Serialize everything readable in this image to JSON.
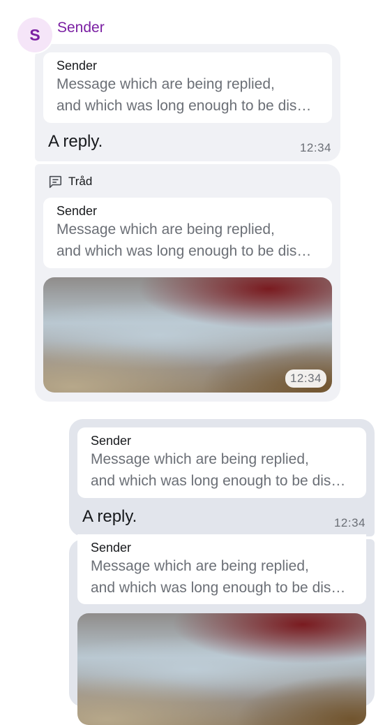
{
  "sender": {
    "initial": "S",
    "name": "Sender"
  },
  "messages": [
    {
      "quote": {
        "sender": "Sender",
        "line1": "Message which are being replied,",
        "line2": "and which was long enough to be displayed on two lines"
      },
      "text": "A reply.",
      "time": "12:34"
    },
    {
      "thread_label": "Tråd",
      "quote": {
        "sender": "Sender",
        "line1": "Message which are being replied,",
        "line2": "and which was long enough to be displayed on two lines"
      },
      "time": "12:34"
    },
    {
      "quote": {
        "sender": "Sender",
        "line1": "Message which are being replied,",
        "line2": "and which was long enough to be displayed on two lines"
      },
      "text": "A reply.",
      "time": "12:34"
    },
    {
      "quote": {
        "sender": "Sender",
        "line1": "Message which are being replied,",
        "line2": "and which was long enough to be displayed on two lines"
      }
    }
  ],
  "icons": {
    "thread": "thread-icon"
  },
  "colors": {
    "sender_accent": "#7a1fa2",
    "incoming_bubble": "#f0f1f5",
    "outgoing_bubble": "#e2e5ec"
  }
}
